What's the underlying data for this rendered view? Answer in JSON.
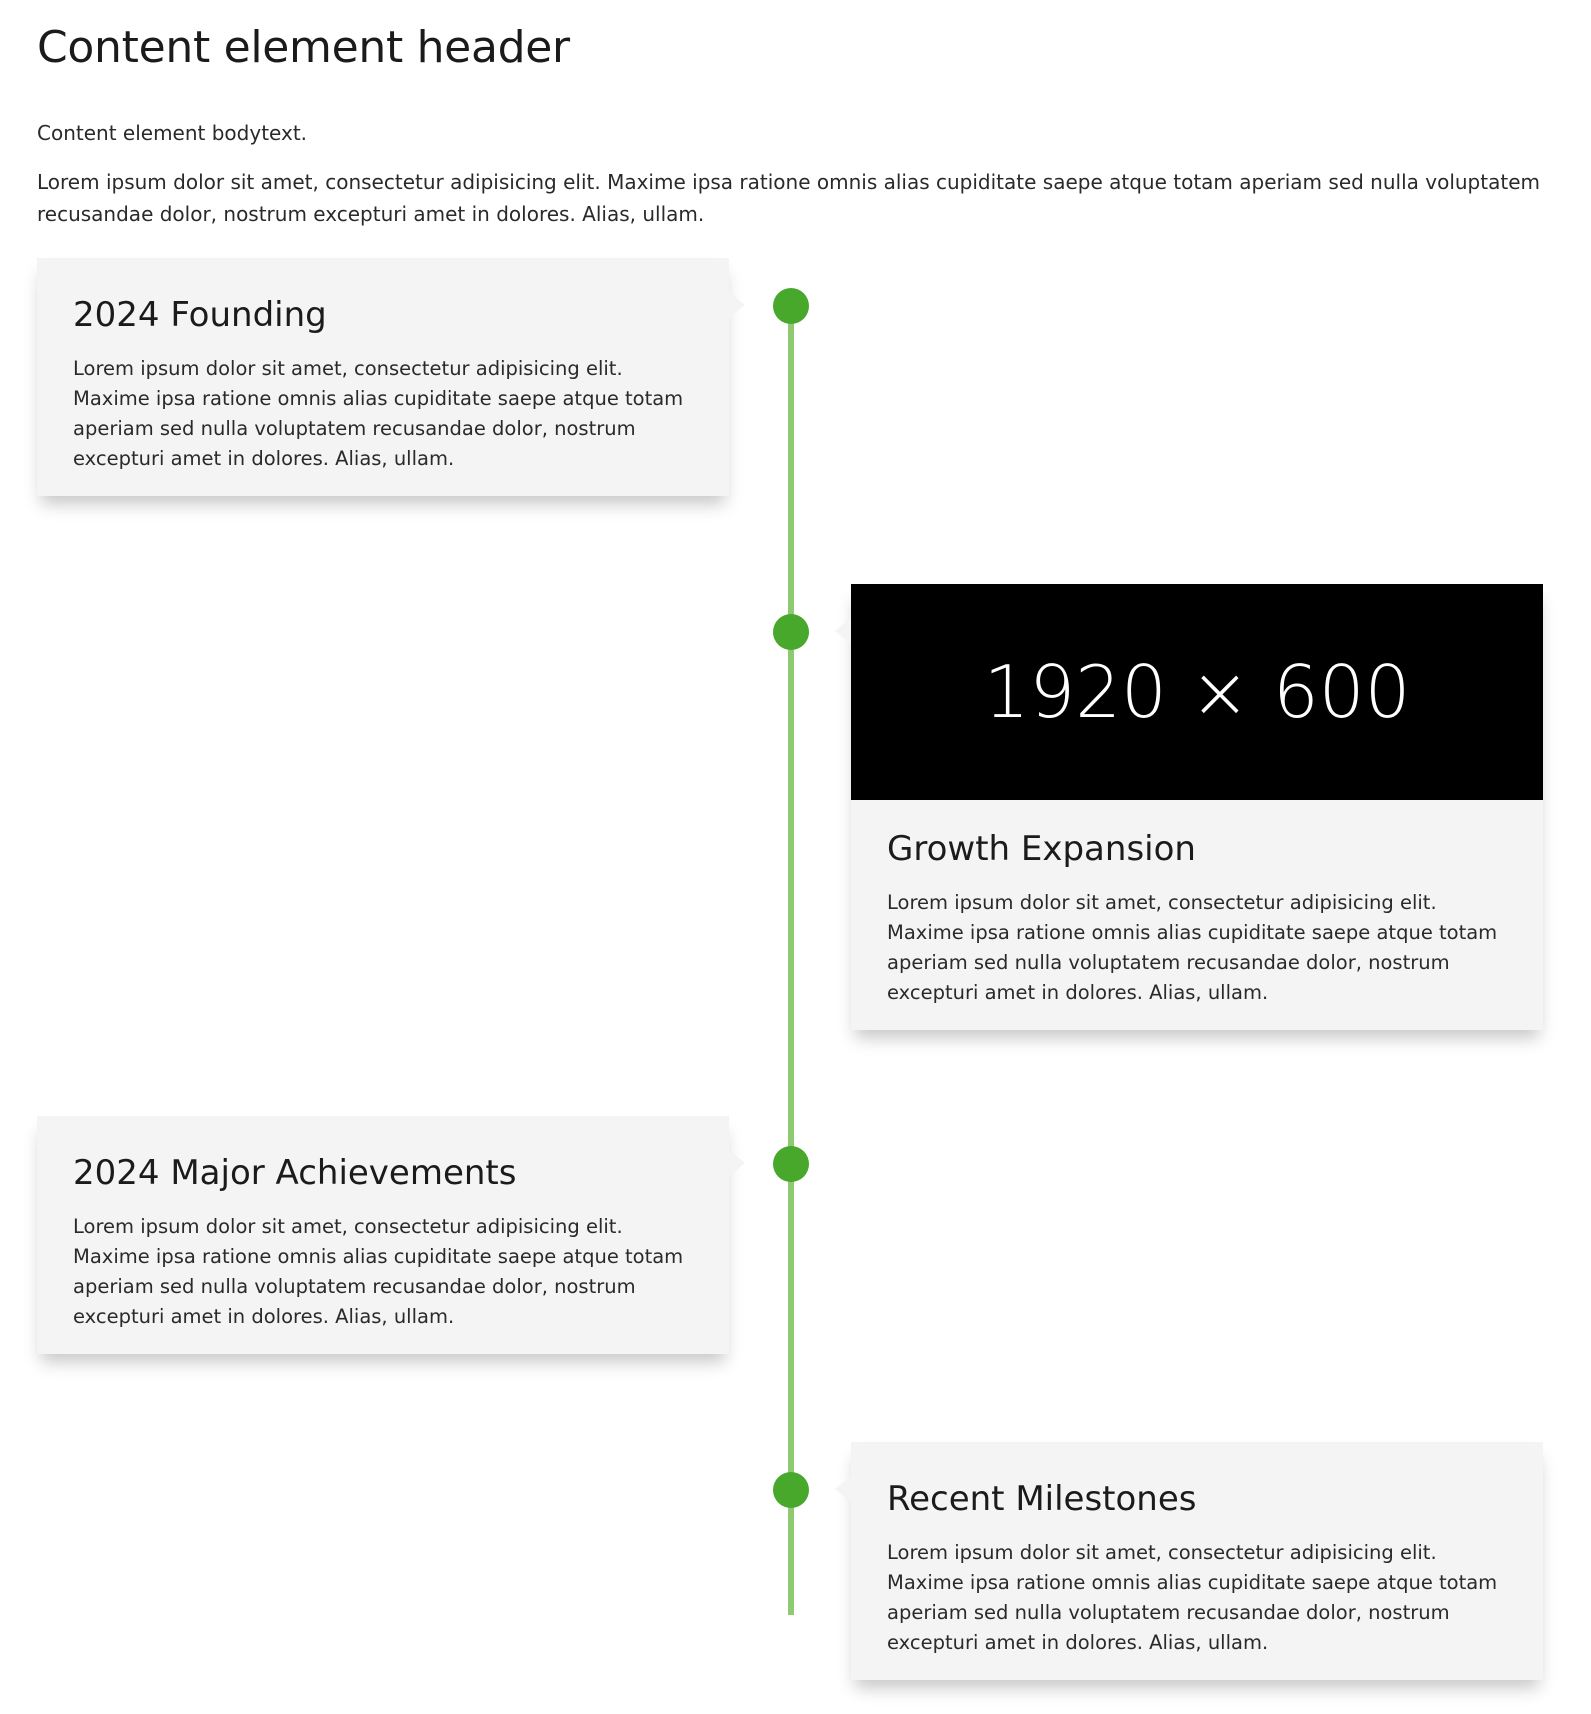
{
  "header": {
    "title": "Content element header",
    "lead": "Content element bodytext.",
    "intro": "Lorem ipsum dolor sit amet, consectetur adipisicing elit. Maxime ipsa ratione omnis alias cupiditate saepe atque totam aperiam sed nulla voluptatem recusandae dolor, nostrum excepturi amet in dolores. Alias, ullam."
  },
  "colors": {
    "accent": "#47a82c",
    "line": "#8dca72",
    "card_bg": "#f4f4f4"
  },
  "timeline": {
    "items": [
      {
        "title": "2024 Founding",
        "text": "Lorem ipsum dolor sit amet, consectetur adipisicing elit. Maxime ipsa ratione omnis alias cupiditate saepe atque totam aperiam sed nulla voluptatem recusandae dolor, nostrum excepturi amet in dolores. Alias, ullam."
      },
      {
        "image_label": "1920 × 600",
        "title": "Growth Expansion",
        "text": "Lorem ipsum dolor sit amet, consectetur adipisicing elit. Maxime ipsa ratione omnis alias cupiditate saepe atque totam aperiam sed nulla voluptatem recusandae dolor, nostrum excepturi amet in dolores. Alias, ullam."
      },
      {
        "title": "2024 Major Achievements",
        "text": "Lorem ipsum dolor sit amet, consectetur adipisicing elit. Maxime ipsa ratione omnis alias cupiditate saepe atque totam aperiam sed nulla voluptatem recusandae dolor, nostrum excepturi amet in dolores. Alias, ullam."
      },
      {
        "title": "Recent Milestones",
        "text": "Lorem ipsum dolor sit amet, consectetur adipisicing elit. Maxime ipsa ratione omnis alias cupiditate saepe atque totam aperiam sed nulla voluptatem recusandae dolor, nostrum excepturi amet in dolores. Alias, ullam."
      }
    ]
  }
}
